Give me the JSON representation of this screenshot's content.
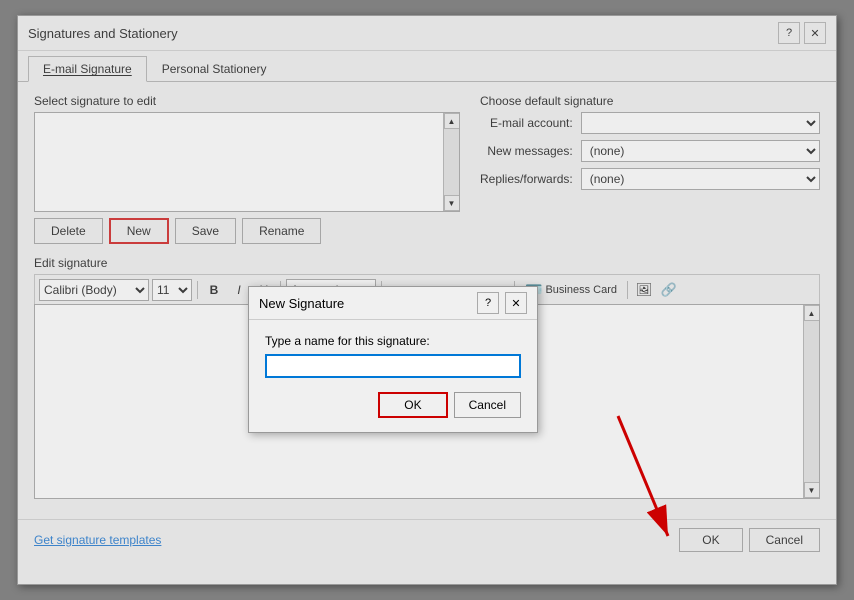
{
  "window": {
    "title": "Signatures and Stationery",
    "help_icon": "?",
    "close_icon": "✕"
  },
  "tabs": {
    "email_sig": "E-mail Signature",
    "personal_stationery": "Personal Stationery"
  },
  "left_panel": {
    "select_label": "Select signature to edit"
  },
  "buttons": {
    "delete": "Delete",
    "new": "New",
    "save": "Save",
    "rename": "Rename"
  },
  "right_panel": {
    "choose_label": "Choose default signature",
    "email_account_label": "E-mail account:",
    "new_messages_label": "New messages:",
    "replies_label": "Replies/forwards:",
    "new_messages_value": "(none)",
    "replies_value": "(none)"
  },
  "edit_sig": {
    "label": "Edit signature",
    "font": "Calibri (Body)",
    "size": "11",
    "color": "Automatic",
    "business_card": "Business Card"
  },
  "toolbar": {
    "bold": "B",
    "italic": "I",
    "underline": "U"
  },
  "bottom": {
    "link_text": "Get signature templates",
    "ok": "OK",
    "cancel": "Cancel"
  },
  "new_sig_dialog": {
    "title": "New Signature",
    "help_icon": "?",
    "close_icon": "✕",
    "label": "Type a name for this signature:",
    "input_value": "",
    "ok": "OK",
    "cancel": "Cancel"
  }
}
